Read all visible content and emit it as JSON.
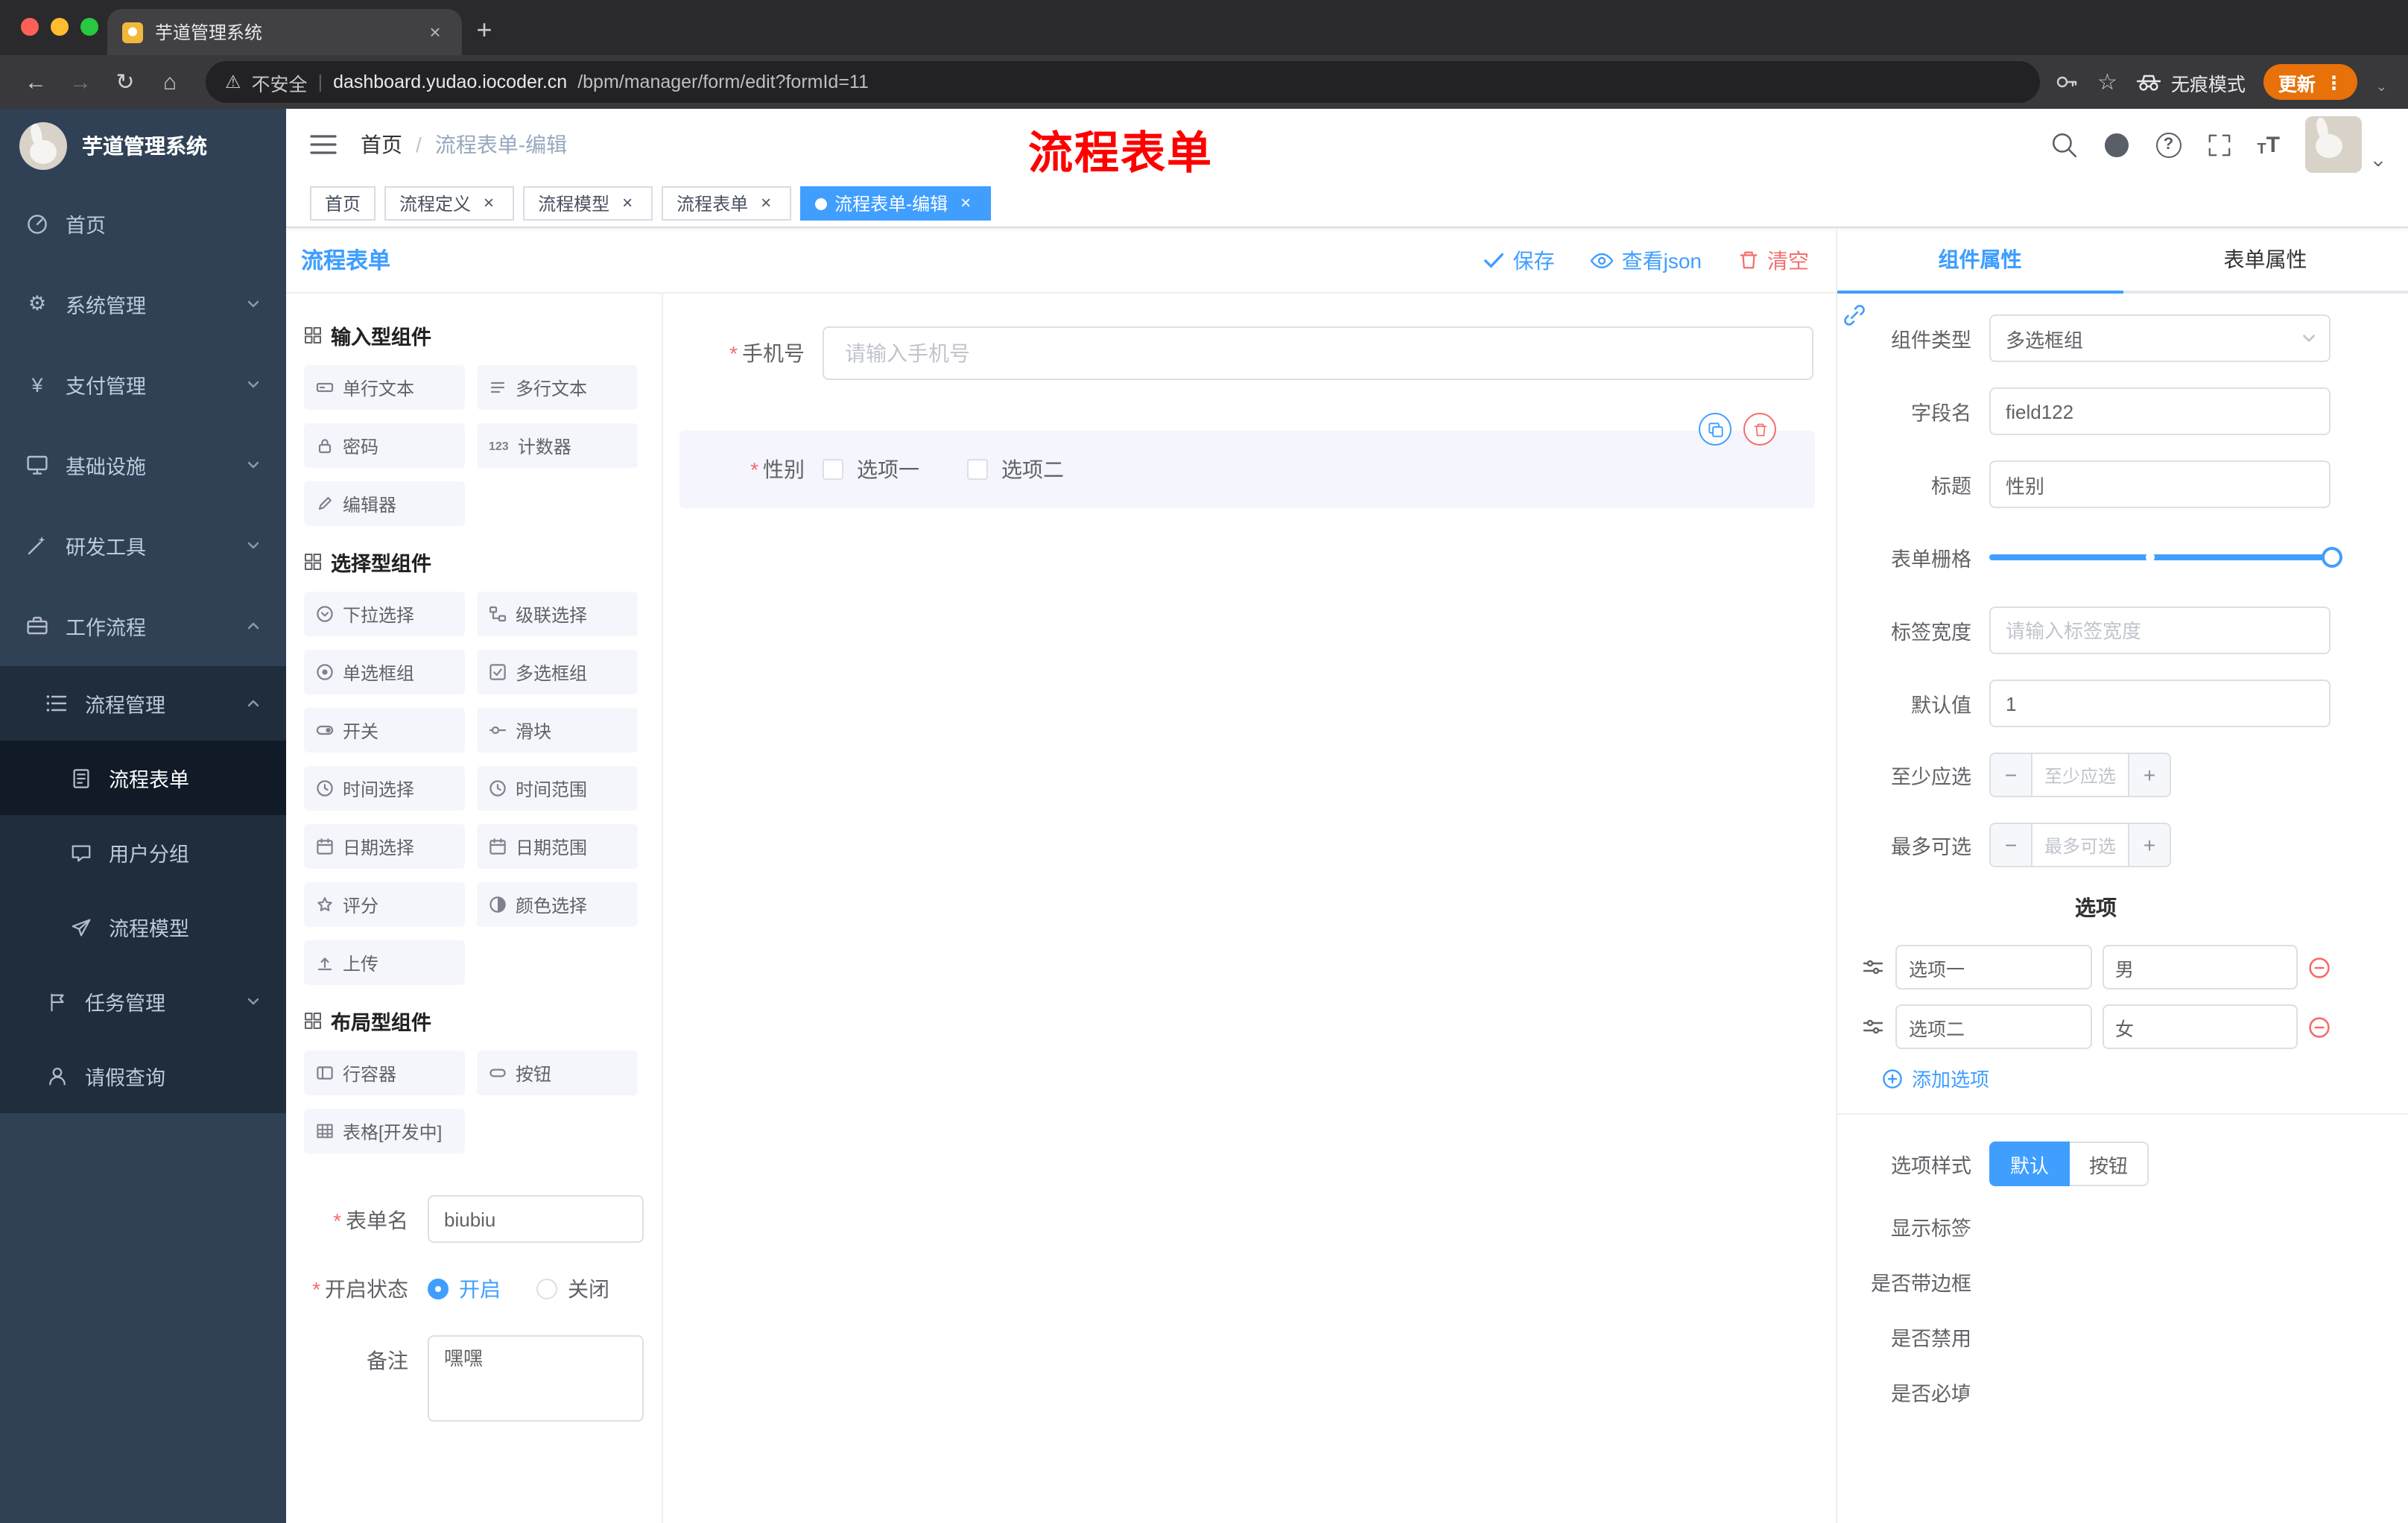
{
  "colors": {
    "primary": "#409eff",
    "danger": "#f56c6c",
    "annotation": "#ff0000",
    "active_tag": "#409eff",
    "update_button": "#e8710a",
    "sidebar_bg": "#304156"
  },
  "icons": {
    "back": "←",
    "forward": "→",
    "reload": "↻",
    "home": "⌂",
    "warning": "⚠",
    "star": "☆",
    "dots": "⋮",
    "plus": "+",
    "close": "×",
    "gear": "⚙",
    "yen": "¥",
    "question": "?",
    "slash": "/",
    "divider": "|",
    "asterisk": "*",
    "minus": "−",
    "counter": "123",
    "font": "T",
    "caret": "⌄"
  },
  "browser": {
    "tab_title": "芋道管理系统",
    "security_label": "不安全",
    "url_domain": "dashboard.yudao.iocoder.cn",
    "url_path": "/bpm/manager/form/edit?formId=11",
    "incognito_label": "无痕模式",
    "update_label": "更新"
  },
  "sidebar": {
    "logo_title": "芋道管理系统",
    "items": [
      {
        "label": "首页"
      },
      {
        "label": "系统管理"
      },
      {
        "label": "支付管理"
      },
      {
        "label": "基础设施"
      },
      {
        "label": "研发工具"
      },
      {
        "label": "工作流程"
      }
    ],
    "process_group": {
      "label": "流程管理"
    },
    "process_children": [
      {
        "label": "流程表单"
      },
      {
        "label": "用户分组"
      },
      {
        "label": "流程模型"
      }
    ],
    "task_group": {
      "label": "任务管理"
    },
    "leave_item": {
      "label": "请假查询"
    }
  },
  "navbar": {
    "breadcrumb_home": "首页",
    "breadcrumb_current": "流程表单-编辑",
    "annotation": "流程表单"
  },
  "tags": [
    {
      "label": "首页"
    },
    {
      "label": "流程定义"
    },
    {
      "label": "流程模型"
    },
    {
      "label": "流程表单"
    },
    {
      "label": "流程表单-编辑"
    }
  ],
  "designer": {
    "title": "流程表单",
    "save_label": "保存",
    "view_json_label": "查看json",
    "clear_label": "清空",
    "groups": [
      {
        "title": "输入型组件",
        "items": [
          "单行文本",
          "多行文本",
          "密码",
          "计数器",
          "编辑器"
        ]
      },
      {
        "title": "选择型组件",
        "items": [
          "下拉选择",
          "级联选择",
          "单选框组",
          "多选框组",
          "开关",
          "滑块",
          "时间选择",
          "时间范围",
          "日期选择",
          "日期范围",
          "评分",
          "颜色选择",
          "上传"
        ]
      },
      {
        "title": "布局型组件",
        "items": [
          "行容器",
          "按钮",
          "表格[开发中]"
        ]
      }
    ],
    "meta": {
      "form_name_label": "表单名",
      "form_name_value": "biubiu",
      "status_label": "开启状态",
      "status_on": "开启",
      "status_off": "关闭",
      "remark_label": "备注",
      "remark_value": "嘿嘿"
    },
    "canvas": {
      "phone_label": "手机号",
      "phone_placeholder": "请输入手机号",
      "gender_label": "性别",
      "gender_options": [
        "选项一",
        "选项二"
      ]
    }
  },
  "properties": {
    "tab_component": "组件属性",
    "tab_form": "表单属性",
    "type_label": "组件类型",
    "type_value": "多选框组",
    "field_label": "字段名",
    "field_value": "field122",
    "title_label": "标题",
    "title_value": "性别",
    "grid_label": "表单栅格",
    "tag_width_label": "标签宽度",
    "tag_width_placeholder": "请输入标签宽度",
    "default_label": "默认值",
    "default_value": "1",
    "min_label": "至少应选",
    "min_placeholder": "至少应选",
    "max_label": "最多可选",
    "max_placeholder": "最多可选",
    "options_title": "选项",
    "options": [
      {
        "label": "选项一",
        "value": "男"
      },
      {
        "label": "选项二",
        "value": "女"
      }
    ],
    "add_option_label": "添加选项",
    "style_label": "选项样式",
    "style_default": "默认",
    "style_button": "按钮",
    "toggle_show_label": "显示标签",
    "toggle_border": "是否带边框",
    "toggle_disabled": "是否禁用",
    "toggle_required": "是否必填"
  }
}
